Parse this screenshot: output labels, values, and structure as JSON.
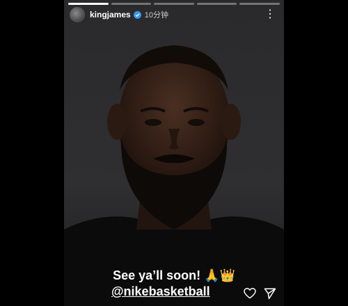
{
  "story": {
    "username": "kingjames",
    "time": "10分钟",
    "segments": 5,
    "active_segment": 1
  },
  "caption": {
    "line1": "See ya’ll soon! 🙏👑",
    "line2": "@nikebasketball"
  },
  "icons": [
    "more-icon",
    "verified-icon",
    "heart-icon",
    "send-icon"
  ],
  "colors": {
    "verified": "#3897f0",
    "text": "#ffffff"
  }
}
